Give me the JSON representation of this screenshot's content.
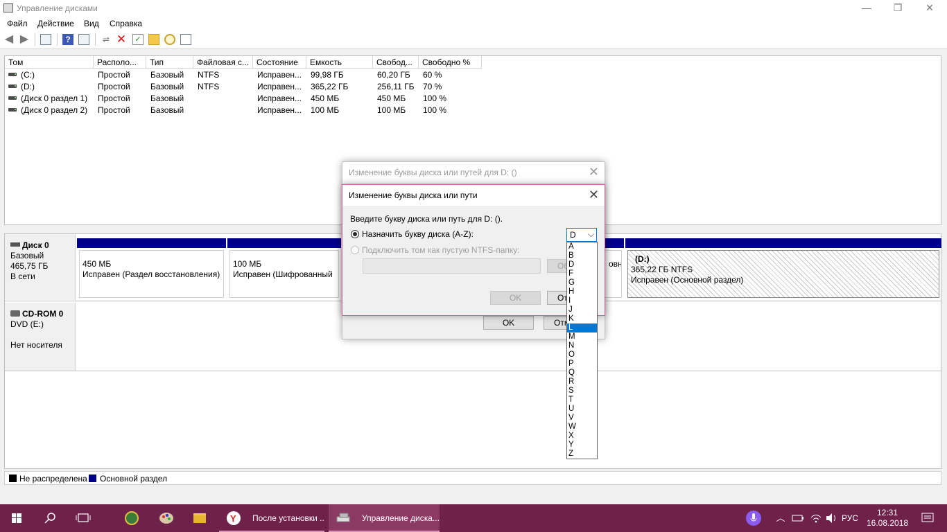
{
  "window": {
    "title": "Управление дисками",
    "minimize": "—",
    "maximize": "❐",
    "close": "✕"
  },
  "menu": [
    "Файл",
    "Действие",
    "Вид",
    "Справка"
  ],
  "volume_table": {
    "headers": [
      "Том",
      "Располо...",
      "Тип",
      "Файловая с...",
      "Состояние",
      "Емкость",
      "Свобод...",
      "Свободно %"
    ],
    "rows": [
      [
        "(C:)",
        "Простой",
        "Базовый",
        "NTFS",
        "Исправен...",
        "99,98 ГБ",
        "60,20 ГБ",
        "60 %"
      ],
      [
        "(D:)",
        "Простой",
        "Базовый",
        "NTFS",
        "Исправен...",
        "365,22 ГБ",
        "256,11 ГБ",
        "70 %"
      ],
      [
        "(Диск 0 раздел 1)",
        "Простой",
        "Базовый",
        "",
        "Исправен...",
        "450 МБ",
        "450 МБ",
        "100 %"
      ],
      [
        "(Диск 0 раздел 2)",
        "Простой",
        "Базовый",
        "",
        "Исправен...",
        "100 МБ",
        "100 МБ",
        "100 %"
      ]
    ]
  },
  "disk0": {
    "name": "Диск 0",
    "type": "Базовый",
    "size": "465,75 ГБ",
    "status": "В сети",
    "partitions": [
      {
        "line1": "450 МБ",
        "line2": "Исправен (Раздел восстановления)"
      },
      {
        "line1": "100 МБ",
        "line2": "Исправен (Шифрованный"
      },
      {
        "line1": "",
        "line2": "овно"
      },
      {
        "label": "(D:)",
        "line1": "365,22 ГБ NTFS",
        "line2": "Исправен (Основной раздел)"
      }
    ]
  },
  "cdrom": {
    "name": "CD-ROM 0",
    "drive": "DVD (E:)",
    "status": "Нет носителя"
  },
  "legend": {
    "unallocated": "Не распределена",
    "primary": "Основной раздел"
  },
  "colors": {
    "unallocated": "#000000",
    "primary": "#00008b",
    "taskbar": "#6e2149",
    "accent": "#0078d7"
  },
  "dialog_back": {
    "title": "Изменение буквы диска или путей для D: ()",
    "ok": "OK",
    "cancel": "Отм",
    "close": "✕"
  },
  "dialog_front": {
    "title": "Изменение буквы диска или пути",
    "prompt": "Введите букву диска или путь для D: ().",
    "assign_label": "Назначить букву диска (A-Z):",
    "mount_label": "Подключить том как пустую NTFS-папку:",
    "browse": "Об",
    "ok": "OK",
    "cancel": "От",
    "close": "✕",
    "selected_letter": "D",
    "letters": [
      "A",
      "B",
      "D",
      "F",
      "G",
      "H",
      "I",
      "J",
      "K",
      "L",
      "M",
      "N",
      "O",
      "P",
      "Q",
      "R",
      "S",
      "T",
      "U",
      "V",
      "W",
      "X",
      "Y",
      "Z"
    ],
    "highlighted": "L"
  },
  "taskbar": {
    "tasks": [
      "После установки ...",
      "Управление диска..."
    ],
    "lang": "РУС",
    "time": "12:31",
    "date": "16.08.2018"
  }
}
